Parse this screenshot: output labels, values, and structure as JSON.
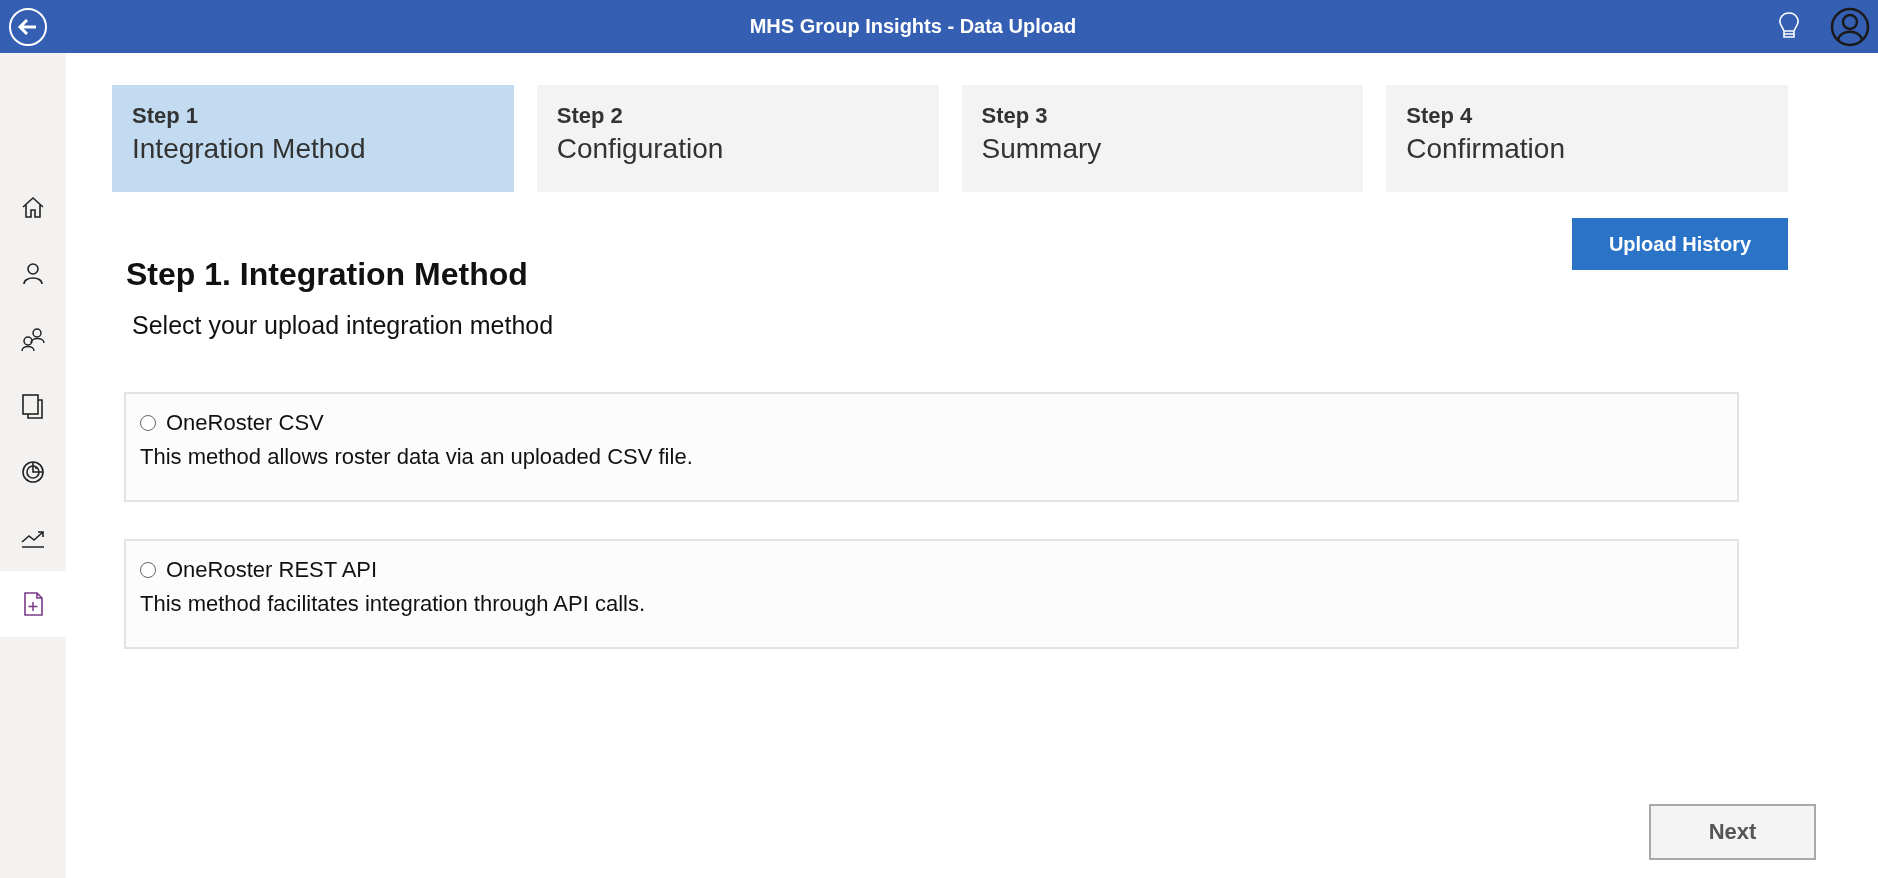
{
  "header": {
    "title": "MHS Group Insights - Data Upload"
  },
  "sidebar": {
    "items": [
      {
        "kind": "home",
        "selected": false
      },
      {
        "kind": "person",
        "selected": false
      },
      {
        "kind": "people",
        "selected": false
      },
      {
        "kind": "pages",
        "selected": false
      },
      {
        "kind": "radar",
        "selected": false
      },
      {
        "kind": "trend",
        "selected": false
      },
      {
        "kind": "upload",
        "selected": true
      }
    ]
  },
  "steps": [
    {
      "step": "Step 1",
      "label": "Integration Method",
      "selected": true
    },
    {
      "step": "Step 2",
      "label": "Configuration",
      "selected": false
    },
    {
      "step": "Step 3",
      "label": "Summary",
      "selected": false
    },
    {
      "step": "Step 4",
      "label": "Confirmation",
      "selected": false
    }
  ],
  "upload_history_button": "Upload History",
  "heading": "Step 1. Integration Method",
  "subtitle": "Select your upload integration method",
  "options": [
    {
      "title": "OneRoster CSV",
      "description": "This method allows roster data via an uploaded CSV file.",
      "selected": false
    },
    {
      "title": "OneRoster REST API",
      "description": "This method facilitates integration through API calls.",
      "selected": false
    }
  ],
  "next_button": {
    "label": "Next",
    "disabled": true
  }
}
